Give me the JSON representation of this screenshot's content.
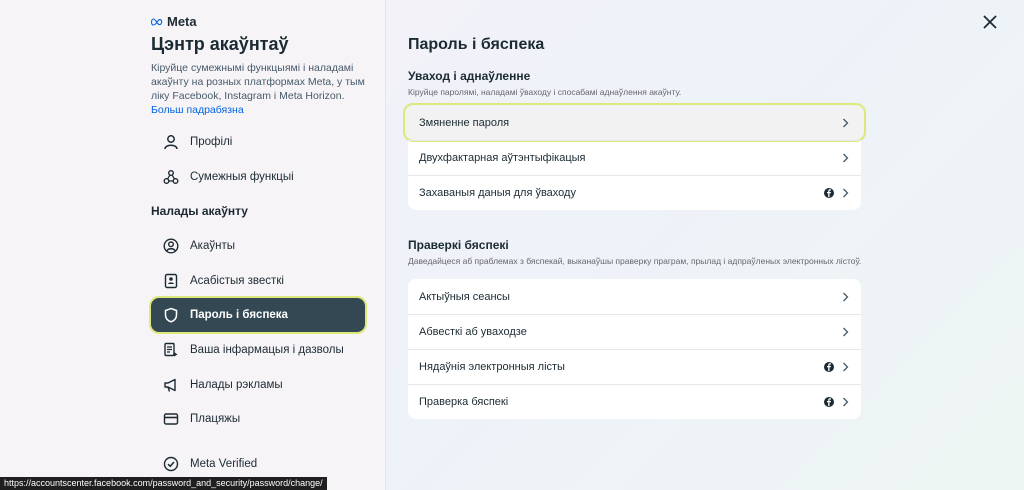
{
  "sidebar": {
    "brand": "Meta",
    "title": "Цэнтр акаўнтаў",
    "description": "Кіруйце сумежнымі функцыямі і наладамі акаўнту на розных платформах Meta, у тым ліку Facebook, Instagram і Meta Horizon.",
    "learn_more": "Больш падрабязна",
    "items_top": [
      {
        "label": "Профілі",
        "icon": "profile-icon"
      },
      {
        "label": "Сумежныя функцыі",
        "icon": "connected-features-icon"
      }
    ],
    "section_label": "Налады акаўнту",
    "items": [
      {
        "label": "Акаўнты",
        "icon": "account-icon"
      },
      {
        "label": "Асабістыя звесткі",
        "icon": "id-card-icon"
      },
      {
        "label": "Пароль і бяспека",
        "icon": "shield-icon",
        "active": true
      },
      {
        "label": "Ваша інфармацыя і дазволы",
        "icon": "info-permissions-icon"
      },
      {
        "label": "Налады рэкламы",
        "icon": "megaphone-icon"
      },
      {
        "label": "Плацяжы",
        "icon": "card-icon"
      },
      {
        "label": "Meta Verified",
        "icon": "verified-icon"
      }
    ]
  },
  "main": {
    "title": "Пароль і бяспека",
    "login_group": {
      "title": "Уваход і аднаўленне",
      "subtitle": "Кіруйце паролямі, наладамі ўваходу і спосабамі аднаўлення акаўнту.",
      "rows": [
        {
          "label": "Змяненне пароля",
          "facebook": false,
          "focused": true
        },
        {
          "label": "Двухфактарная аўтэнтыфікацыя",
          "facebook": false
        },
        {
          "label": "Захаваныя даныя для ўваходу",
          "facebook": true
        }
      ]
    },
    "security_group": {
      "title": "Праверкі бяспекі",
      "subtitle": "Даведайцеся аб праблемах з бяспекай, выканаўшы праверку праграм, прылад і адпраўленых электронных лістоў.",
      "rows": [
        {
          "label": "Актыўныя сеансы",
          "facebook": false
        },
        {
          "label": "Абвесткі аб уваходзе",
          "facebook": false
        },
        {
          "label": "Нядаўнія электронныя лісты",
          "facebook": true
        },
        {
          "label": "Праверка бяспекі",
          "facebook": true
        }
      ]
    }
  },
  "status_bar": {
    "url": "https://accountscenter.facebook.com/password_and_security/password/change/"
  },
  "colors": {
    "active_bg": "#344854",
    "focus_ring": "#dde87b",
    "link": "#0064e0"
  }
}
